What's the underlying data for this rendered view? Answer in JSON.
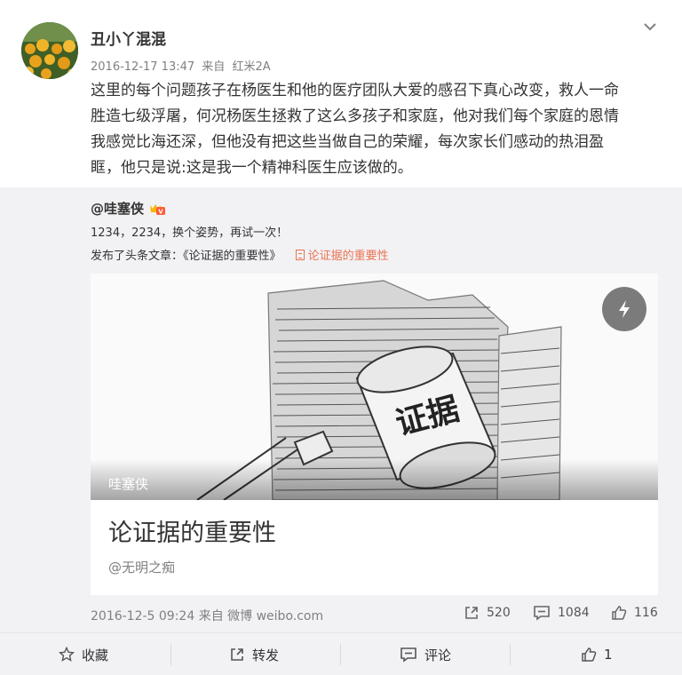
{
  "post": {
    "username": "丑小丫混混",
    "time": "2016-12-17 13:47",
    "source_prefix": "来自",
    "device": "红米2A",
    "body_lines": [
      "这里的每个问题孩子在杨医生和他的医疗团队大爱的感召下真心改变，救人一命",
      "胜造七级浮屠，何况杨医生拯救了这么多孩子和家庭，他对我们每个家庭的恩情",
      "我感觉比海还深，但他没有把这些当做自己的荣耀，每次家长们感动的热泪盈",
      "眶，他只是说:这是我一个精神科医生应该做的。"
    ]
  },
  "repost": {
    "author": "@哇塞侠",
    "text": "1234，2234，换个姿势，再试一次！",
    "article_prefix": "发布了头条文章：《论证据的重要性》",
    "article_link": "论证据的重要性",
    "card": {
      "image_author": "哇塞侠",
      "image_caption": "证据",
      "title": "论证据的重要性",
      "subtitle": "@无明之痴"
    },
    "time": "2016-12-5 09:24",
    "source_prefix": "来自",
    "source": "微博 weibo.com",
    "reposts": "520",
    "comments": "1084",
    "likes": "116"
  },
  "toolbar": {
    "favorite": "收藏",
    "repost": "转发",
    "comment": "评论",
    "like": "1"
  },
  "colors": {
    "accent_orange": "#eb7350",
    "meta_gray": "#808080",
    "repost_bg": "#f2f2f5"
  }
}
